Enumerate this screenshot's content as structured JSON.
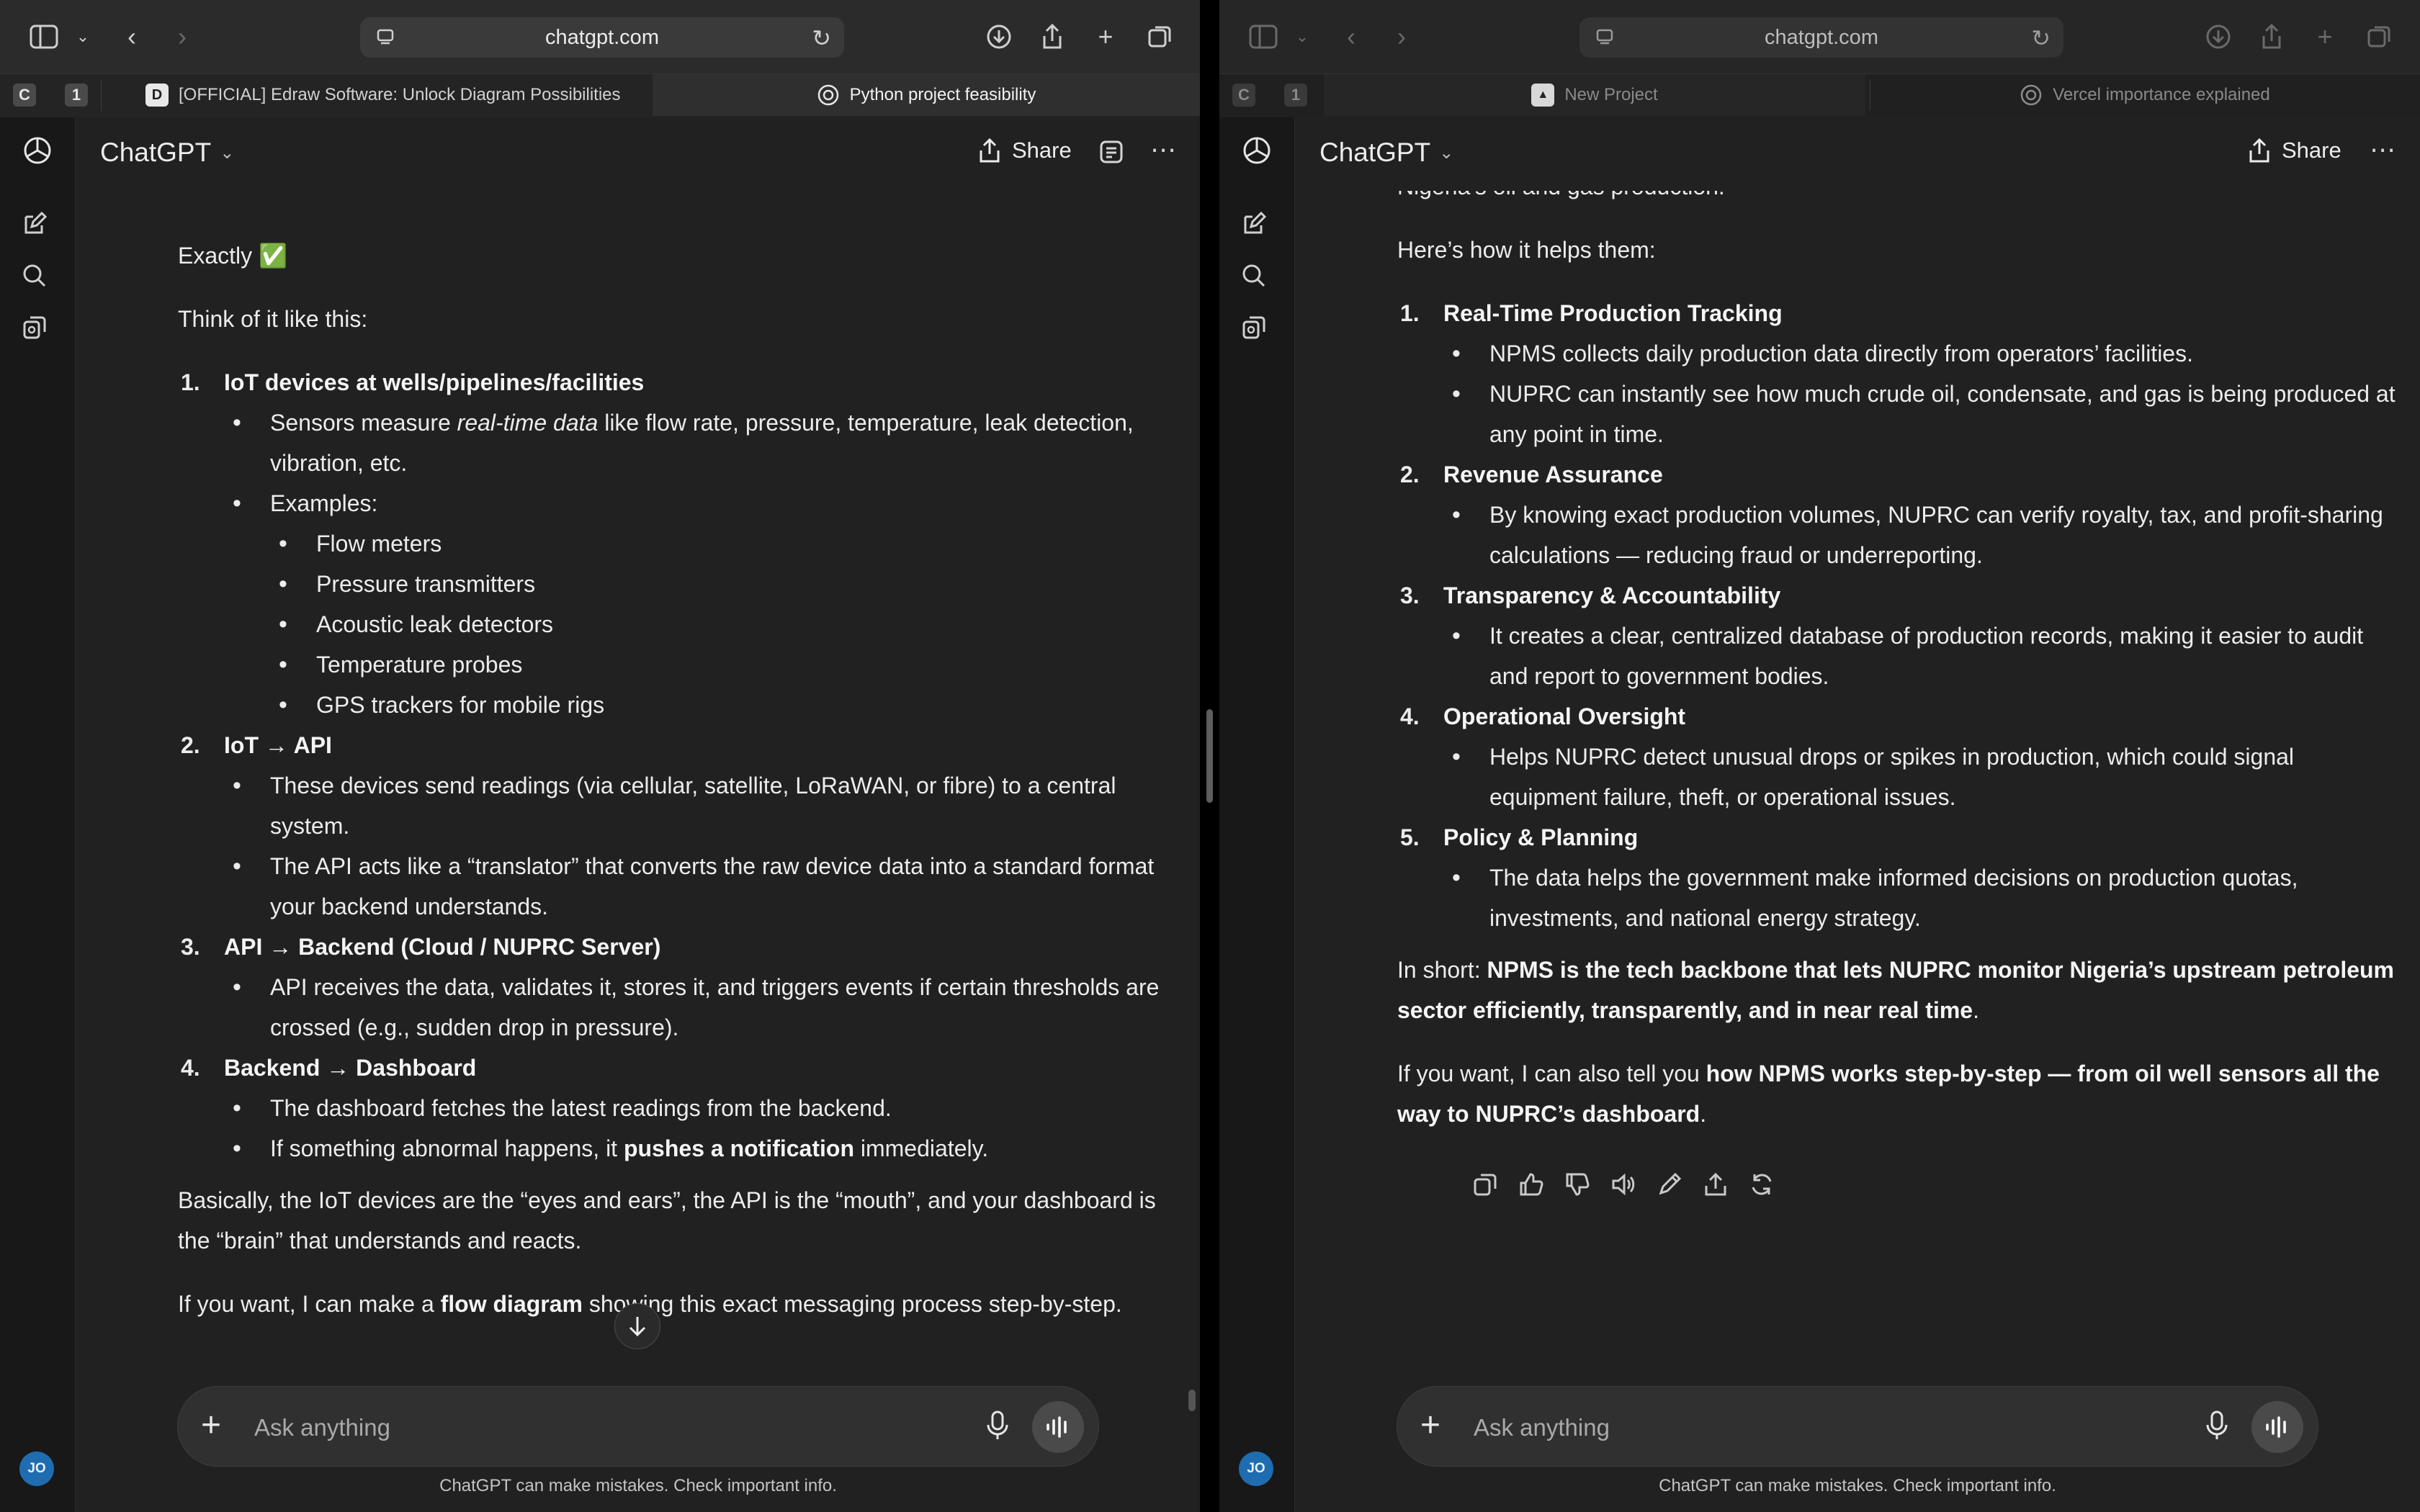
{
  "colors": {
    "window_bg": "#212121",
    "rail_bg": "#181818",
    "toolbar_bg": "#2b2b2b",
    "composer_bg": "#303030",
    "avatar": "#1f6cb0",
    "text": "#ececec"
  },
  "left": {
    "address": "chatgpt.com",
    "tab_badges": [
      "C",
      "1"
    ],
    "tabs": [
      {
        "label": "[OFFICIAL] Edraw Software: Unlock Diagram Possibilities",
        "favicon": "edraw-icon"
      },
      {
        "label": "Python project feasibility",
        "favicon": "openai-icon"
      }
    ],
    "model": "ChatGPT",
    "share_label": "Share",
    "avatar": "JO",
    "message": {
      "intro": "Exactly ✅",
      "think": "Think of it like this:",
      "steps": [
        {
          "num": "1.",
          "title": "IoT devices at wells/pipelines/facilities",
          "b1_pre": "Sensors measure ",
          "b1_em": "real-time data",
          "b1_post": " like flow rate, pressure, temperature, leak detection, vibration, etc.",
          "b2": "Examples:",
          "examples": [
            "Flow meters",
            "Pressure transmitters",
            "Acoustic leak detectors",
            "Temperature probes",
            "GPS trackers for mobile rigs"
          ]
        },
        {
          "num": "2.",
          "title": "IoT → API",
          "bullets": [
            "These devices send readings (via cellular, satellite, LoRaWAN, or fibre) to a central system.",
            "The API acts like a “translator” that converts the raw device data into a standard format your backend understands."
          ]
        },
        {
          "num": "3.",
          "title": "API → Backend (Cloud / NUPRC Server)",
          "bullets": [
            "API receives the data, validates it, stores it, and triggers events if certain thresholds are crossed (e.g., sudden drop in pressure)."
          ]
        },
        {
          "num": "4.",
          "title": "Backend → Dashboard",
          "b1": "The dashboard fetches the latest readings from the backend.",
          "b2_pre": "If something abnormal happens, it ",
          "b2_bold": "pushes a notification",
          "b2_post": " immediately."
        }
      ],
      "summary": "Basically, the IoT devices are the “eyes and ears”, the API is the “mouth”, and your dashboard is the “brain” that understands and reacts.",
      "offer_pre": "If you want, I can make a ",
      "offer_bold": "flow diagram",
      "offer_post": " showing this exact messaging process step-by-step."
    },
    "composer_placeholder": "Ask anything",
    "disclaimer": "ChatGPT can make mistakes. Check important info."
  },
  "right": {
    "address": "chatgpt.com",
    "tab_badges": [
      "C",
      "1"
    ],
    "tabs": [
      {
        "label": "New Project",
        "favicon": "vercel-icon"
      },
      {
        "label": "Vercel importance explained",
        "favicon": "openai-icon"
      }
    ],
    "model": "ChatGPT",
    "share_label": "Share",
    "avatar": "JO",
    "message": {
      "cut_line": "Nigeria’s oil and gas production.",
      "helps": "Here’s how it helps them:",
      "points": [
        {
          "num": "1.",
          "title": "Real-Time Production Tracking",
          "bullets": [
            "NPMS collects daily production data directly from operators’ facilities.",
            "NUPRC can instantly see how much crude oil, condensate, and gas is being produced at any point in time."
          ]
        },
        {
          "num": "2.",
          "title": "Revenue Assurance",
          "bullets": [
            "By knowing exact production volumes, NUPRC can verify royalty, tax, and profit-sharing calculations — reducing fraud or underreporting."
          ]
        },
        {
          "num": "3.",
          "title": "Transparency & Accountability",
          "bullets": [
            "It creates a clear, centralized database of production records, making it easier to audit and report to government bodies."
          ]
        },
        {
          "num": "4.",
          "title": "Operational Oversight",
          "bullets": [
            "Helps NUPRC detect unusual drops or spikes in production, which could signal equipment failure, theft, or operational issues."
          ]
        },
        {
          "num": "5.",
          "title": "Policy & Planning",
          "bullets": [
            "The data helps the government make informed decisions on production quotas, investments, and national energy strategy."
          ]
        }
      ],
      "short_pre": "In short: ",
      "short_bold": "NPMS is the tech backbone that lets NUPRC monitor Nigeria’s upstream petroleum sector efficiently, transparently, and in near real time",
      "short_post": ".",
      "want_pre": "If you want, I can also tell you ",
      "want_bold": "how NPMS works step-by-step — from oil well sensors all the way to NUPRC’s dashboard",
      "want_post": "."
    },
    "composer_placeholder": "Ask anything",
    "disclaimer": "ChatGPT can make mistakes. Check important info."
  }
}
